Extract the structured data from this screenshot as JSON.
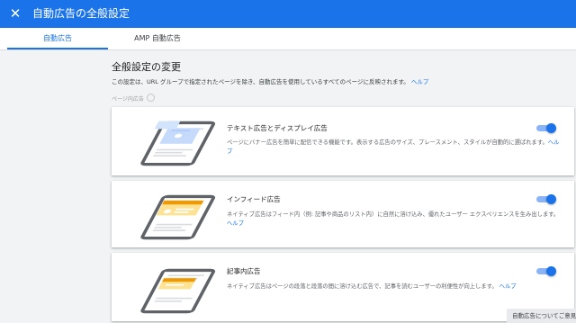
{
  "header": {
    "title": "自動広告の全般設定",
    "close_icon": "close-icon"
  },
  "tabs": [
    {
      "label": "自動広告",
      "active": true
    },
    {
      "label": "AMP 自動広告",
      "active": false
    }
  ],
  "main": {
    "heading": "全般設定の変更",
    "description": "この設定は、URL グループで指定されたページを除き、自動広告を使用しているすべてのページに反映されます。",
    "help_label": "ヘルプ",
    "section_label": "ページ内広告"
  },
  "cards": [
    {
      "title": "テキスト広告とディスプレイ広告",
      "description": "ページにバナー広告を簡単に配信できる機能です。表示する広告のサイズ、プレースメント、スタイルが自動的に選ばれます。",
      "help_label": "ヘルプ",
      "enabled": true
    },
    {
      "title": "インフィード広告",
      "description": "ネイティブ広告はフィード内（例: 記事や商品のリスト内）に自然に溶け込み、優れたユーザー エクスペリエンスを生み出します。",
      "help_label": "ヘルプ",
      "enabled": true
    },
    {
      "title": "記事内広告",
      "description": "ネイティブ広告はページの段落と段落の間に溶け込む広告で、記事を読むユーザーの利便性が向上します。",
      "help_label": "ヘルプ",
      "enabled": true
    }
  ],
  "feedback": {
    "label": "自動広告についてご意見"
  },
  "colors": {
    "accent": "#1a73e8",
    "ad_blue": "#c6dafc",
    "ad_orange": "#f29900"
  }
}
